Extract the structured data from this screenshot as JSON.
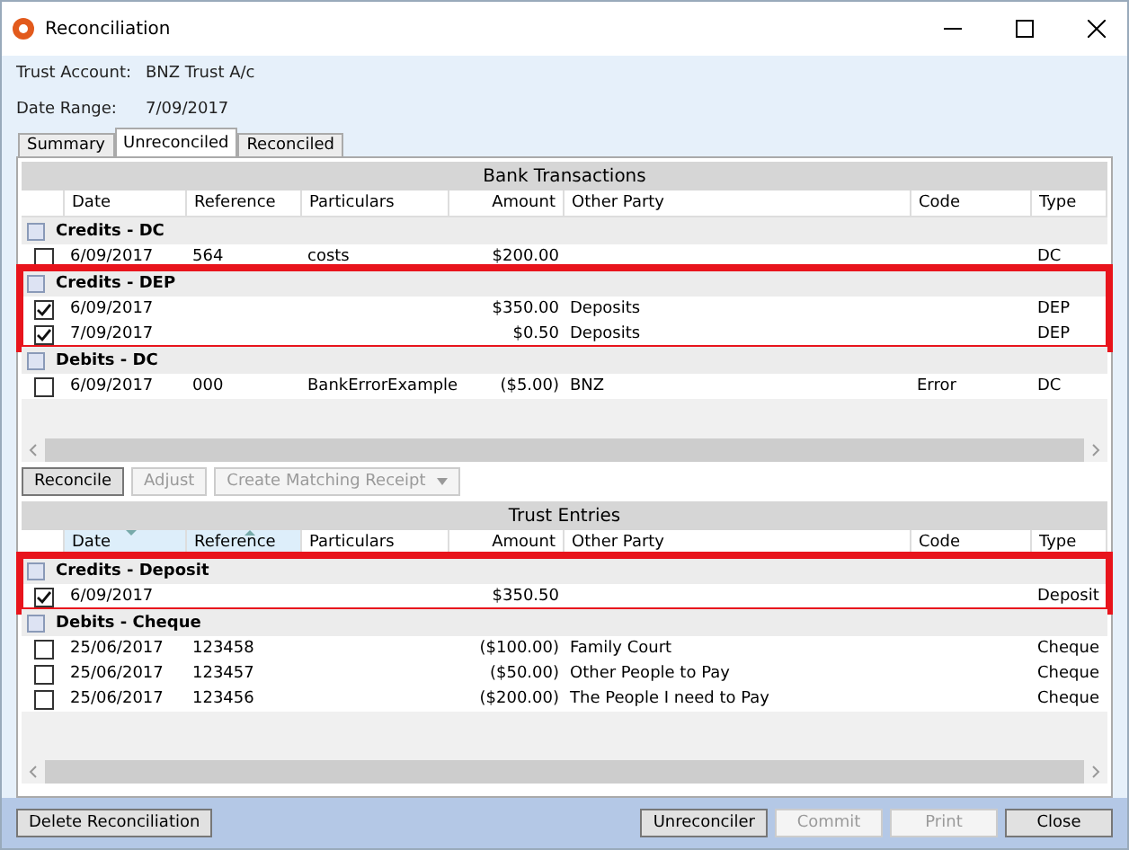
{
  "window": {
    "title": "Reconciliation"
  },
  "info": [
    {
      "label": "Trust Account:",
      "value": "BNZ Trust A/c"
    },
    {
      "label": "Date Range:",
      "value": "7/09/2017"
    }
  ],
  "tabs": [
    {
      "label": "Summary",
      "selected": false
    },
    {
      "label": "Unreconciled",
      "selected": true
    },
    {
      "label": "Reconciled",
      "selected": false
    }
  ],
  "bank": {
    "title": "Bank Transactions",
    "columns": [
      {
        "label": "Date"
      },
      {
        "label": "Reference"
      },
      {
        "label": "Particulars"
      },
      {
        "label": "Amount"
      },
      {
        "label": "Other Party"
      },
      {
        "label": "Code"
      },
      {
        "label": "Type"
      }
    ],
    "groups": [
      {
        "label": "Credits - DC",
        "checked": false,
        "highlighted": false,
        "rows": [
          {
            "checked": false,
            "cells": [
              "6/09/2017",
              "564",
              "costs",
              "$200.00",
              "",
              "",
              "DC"
            ]
          }
        ]
      },
      {
        "label": "Credits - DEP",
        "checked": false,
        "highlighted": true,
        "rows": [
          {
            "checked": true,
            "cells": [
              "6/09/2017",
              "",
              "",
              "$350.00",
              "Deposits",
              "",
              "DEP"
            ]
          },
          {
            "checked": true,
            "cells": [
              "7/09/2017",
              "",
              "",
              "$0.50",
              "Deposits",
              "",
              "DEP"
            ]
          }
        ]
      },
      {
        "label": "Debits - DC",
        "checked": false,
        "highlighted": false,
        "rows": [
          {
            "checked": false,
            "cells": [
              "6/09/2017",
              "000",
              "BankErrorExample",
              "($5.00)",
              "BNZ",
              "Error",
              "DC"
            ]
          }
        ]
      }
    ]
  },
  "actions": [
    {
      "label": "Reconcile",
      "disabled": false,
      "dropdown": false
    },
    {
      "label": "Adjust",
      "disabled": true,
      "dropdown": false
    },
    {
      "label": "Create Matching Receipt",
      "disabled": true,
      "dropdown": true
    }
  ],
  "trust": {
    "title": "Trust Entries",
    "columns": [
      {
        "label": "Date",
        "sorted": true,
        "descending": true
      },
      {
        "label": "Reference",
        "sorted": true,
        "descending": false
      },
      {
        "label": "Particulars"
      },
      {
        "label": "Amount"
      },
      {
        "label": "Other Party"
      },
      {
        "label": "Code"
      },
      {
        "label": "Type"
      }
    ],
    "groups": [
      {
        "label": "Credits - Deposit",
        "checked": false,
        "highlighted": true,
        "rows": [
          {
            "checked": true,
            "cells": [
              "6/09/2017",
              "",
              "",
              "$350.50",
              "",
              "",
              "Deposit"
            ]
          }
        ]
      },
      {
        "label": "Debits - Cheque",
        "checked": false,
        "highlighted": false,
        "rows": [
          {
            "checked": false,
            "cells": [
              "25/06/2017",
              "123458",
              "",
              "($100.00)",
              "Family Court",
              "",
              "Cheque"
            ]
          },
          {
            "checked": false,
            "cells": [
              "25/06/2017",
              "123457",
              "",
              "($50.00)",
              "Other People to Pay",
              "",
              "Cheque"
            ]
          },
          {
            "checked": false,
            "cells": [
              "25/06/2017",
              "123456",
              "",
              "($200.00)",
              "The People I need to Pay",
              "",
              "Cheque"
            ]
          }
        ]
      }
    ]
  },
  "footer": {
    "left": [
      {
        "label": "Delete Reconciliation",
        "disabled": false
      }
    ],
    "right": [
      {
        "label": "Unreconciler",
        "disabled": false
      },
      {
        "label": "Commit",
        "disabled": true
      },
      {
        "label": "Print",
        "disabled": true
      },
      {
        "label": "Close",
        "disabled": false
      }
    ]
  }
}
